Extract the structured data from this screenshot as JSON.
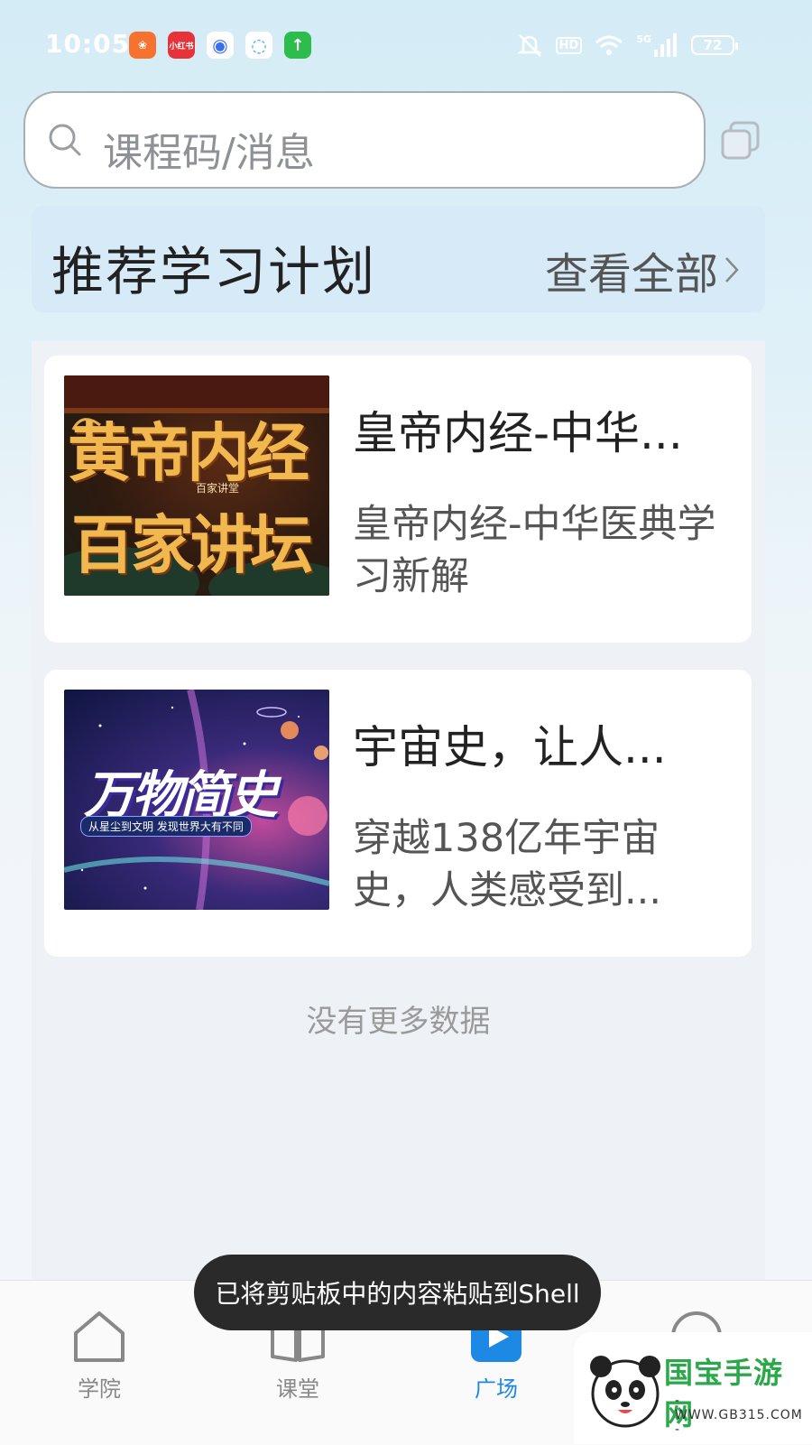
{
  "status_bar": {
    "time": "10:05",
    "notif_icons": [
      {
        "name": "kuaishou-icon",
        "color": "#f5732f",
        "glyph": "❀"
      },
      {
        "name": "xiaohongshu-icon",
        "color": "#e8323a",
        "glyph": "小红书"
      },
      {
        "name": "app-circle-icon",
        "color": "#3a6df0",
        "glyph": "◉"
      },
      {
        "name": "chat-icon",
        "color": "#2ea8f0",
        "glyph": "◌"
      },
      {
        "name": "upload-icon",
        "color": "#2dbd4c",
        "glyph": "↑"
      }
    ],
    "hd": "HD",
    "network": "5G",
    "battery": "72"
  },
  "search": {
    "placeholder": "课程码/消息"
  },
  "plan_section": {
    "title": "推荐学习计划",
    "view_all": "查看全部"
  },
  "courses": [
    {
      "title": "皇帝内经-中华...",
      "desc": "皇帝内经-中华医典学习新解",
      "thumb": {
        "main_line1": "黄帝内经",
        "main_line2": "百家讲坛",
        "badge": "百家讲堂"
      }
    },
    {
      "title": "宇宙史，让人...",
      "desc": "穿越138亿年宇宙史，人类感受到...",
      "thumb": {
        "main": "万物简史",
        "sub": "从星尘到文明 发现世界大有不同"
      }
    }
  ],
  "list_footer": "没有更多数据",
  "bottom_nav": [
    {
      "label": "学院",
      "active": false
    },
    {
      "label": "课堂",
      "active": false
    },
    {
      "label": "广场",
      "active": true
    },
    {
      "label": "",
      "active": false
    }
  ],
  "colors": {
    "active": "#1e88e5",
    "inactive": "#888888"
  },
  "toast": "已将剪贴板中的内容粘贴到Shell",
  "watermark": {
    "brand": "国宝手游网",
    "url": "- WWW.GB315.COM -"
  }
}
